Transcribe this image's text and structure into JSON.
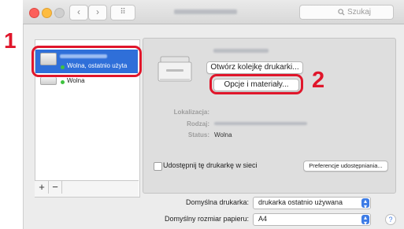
{
  "annotations": {
    "step1": "1",
    "step2": "2"
  },
  "toolbar": {
    "back_glyph": "‹",
    "forward_glyph": "›",
    "grid_glyph": "⠿",
    "search_placeholder": "Szukaj",
    "search_icon": "magnifier-icon"
  },
  "printers": [
    {
      "status": "Wolna, ostatnio użyta",
      "selected": true
    },
    {
      "status": "Wolna",
      "selected": false
    }
  ],
  "sidebar_controls": {
    "add": "+",
    "remove": "−"
  },
  "details": {
    "open_queue_label": "Otwórz kolejkę drukarki...",
    "options_label": "Opcje i materiały...",
    "location_label": "Lokalizacja:",
    "kind_label": "Rodzaj:",
    "status_label": "Status:",
    "status_value": "Wolna",
    "share_label": "Udostępnij tę drukarkę w sieci",
    "share_checked": false,
    "sharing_prefs_label": "Preferencje udostępniania..."
  },
  "defaults": {
    "default_printer_label": "Domyślna drukarka:",
    "default_printer_value": "drukarka ostatnio używana",
    "paper_size_label": "Domyślny rozmiar papieru:",
    "paper_size_value": "A4",
    "help_glyph": "?"
  },
  "colors": {
    "highlight": "#e0162b",
    "selection": "#2f6fd9",
    "status_dot": "#3fc23f"
  }
}
